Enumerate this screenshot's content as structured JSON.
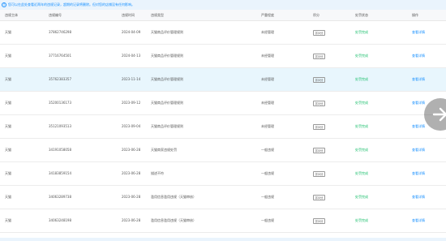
{
  "notice": {
    "icon": "info-icon",
    "text": "您可以在此处查看近两年的违规记录，超期的记录将删除。但对您的店铺没有任何影响。"
  },
  "table": {
    "columns": [
      "违规主体",
      "违规编号",
      "违规时间",
      "违规类型",
      "严重程度",
      "积分",
      "处罚状态",
      "操作"
    ],
    "rows": [
      {
        "subject": "天猫",
        "id": "37862746298",
        "date": "2024-04-09",
        "type": "天猫商品评价管理规则",
        "severity": "未经管理",
        "points": "扣0分",
        "status": "处罚完成",
        "action": "查看详情"
      },
      {
        "subject": "天猫",
        "id": "37716764501",
        "date": "2024-04-13",
        "type": "天猫商品评价管理规则",
        "severity": "未经管理",
        "points": "扣0分",
        "status": "处罚完成",
        "action": "查看详情"
      },
      {
        "subject": "天猫",
        "id": "35762383357",
        "date": "2023-11-14",
        "type": "天猫商品评价管理规则",
        "severity": "未经管理",
        "points": "扣0分",
        "status": "处罚完成",
        "action": "查看详情"
      },
      {
        "subject": "天猫",
        "id": "35200136173",
        "date": "2023-09-12",
        "type": "天猫商品评价管理规则",
        "severity": "未经管理",
        "points": "扣0分",
        "status": "处罚完成",
        "action": "查看详情"
      },
      {
        "subject": "天猫",
        "id": "35121093513",
        "date": "2023-09-04",
        "type": "天猫商品评价管理规则",
        "severity": "未经管理",
        "points": "扣0分",
        "status": "处罚完成",
        "action": "查看详情"
      },
      {
        "subject": "天猫",
        "id": "34191058058",
        "date": "2023-06-28",
        "type": "天猫商家违规处罚",
        "severity": "一般违规",
        "points": "扣0分",
        "status": "处罚完成",
        "action": "查看详情"
      },
      {
        "subject": "天猫",
        "id": "34183859154",
        "date": "2023-06-28",
        "type": "描述不符",
        "severity": "一般违规",
        "points": "扣0分",
        "status": "处罚完成",
        "action": "查看详情"
      },
      {
        "subject": "天猫",
        "id": "34063289738",
        "date": "2023-06-28",
        "type": "滥用信息滥用违规（天猫审核）",
        "severity": "一般违规",
        "points": "扣0分",
        "status": "处罚完成",
        "action": "查看详情"
      },
      {
        "subject": "天猫",
        "id": "34063248198",
        "date": "2023-06-28",
        "type": "滥用信息滥用违规（天猫审核）",
        "severity": "一般违规",
        "points": "扣0分",
        "status": "处罚完成",
        "action": "查看详情"
      }
    ]
  },
  "overlay": {
    "icon": "arrow-right-icon"
  }
}
